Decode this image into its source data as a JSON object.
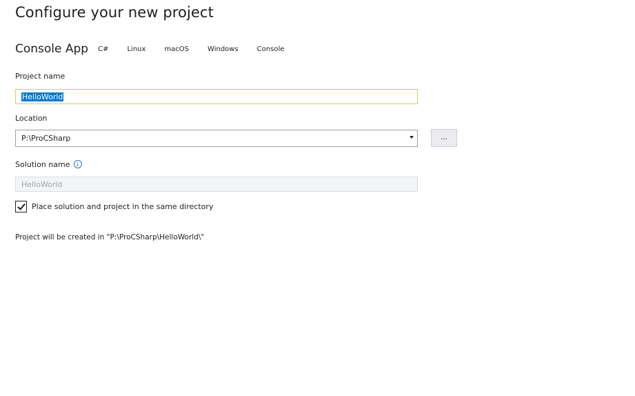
{
  "header": {
    "title": "Configure your new project"
  },
  "template": {
    "name": "Console App",
    "tags": [
      "C#",
      "Linux",
      "macOS",
      "Windows",
      "Console"
    ]
  },
  "form": {
    "project_name": {
      "label": "Project name",
      "value": "HelloWorld"
    },
    "location": {
      "label": "Location",
      "value": "P:\\ProCSharp",
      "browse_label": "..."
    },
    "solution_name": {
      "label": "Solution name",
      "placeholder": "HelloWorld",
      "info_icon": "info-icon"
    },
    "same_directory": {
      "label": "Place solution and project in the same directory",
      "checked": true
    }
  },
  "footer": {
    "created_path": "Project will be created in \"P:\\ProCSharp\\HelloWorld\\\""
  },
  "colors": {
    "focus_border": "#e5c365",
    "selection": "#0078d7",
    "info_blue": "#1e6fd9"
  }
}
